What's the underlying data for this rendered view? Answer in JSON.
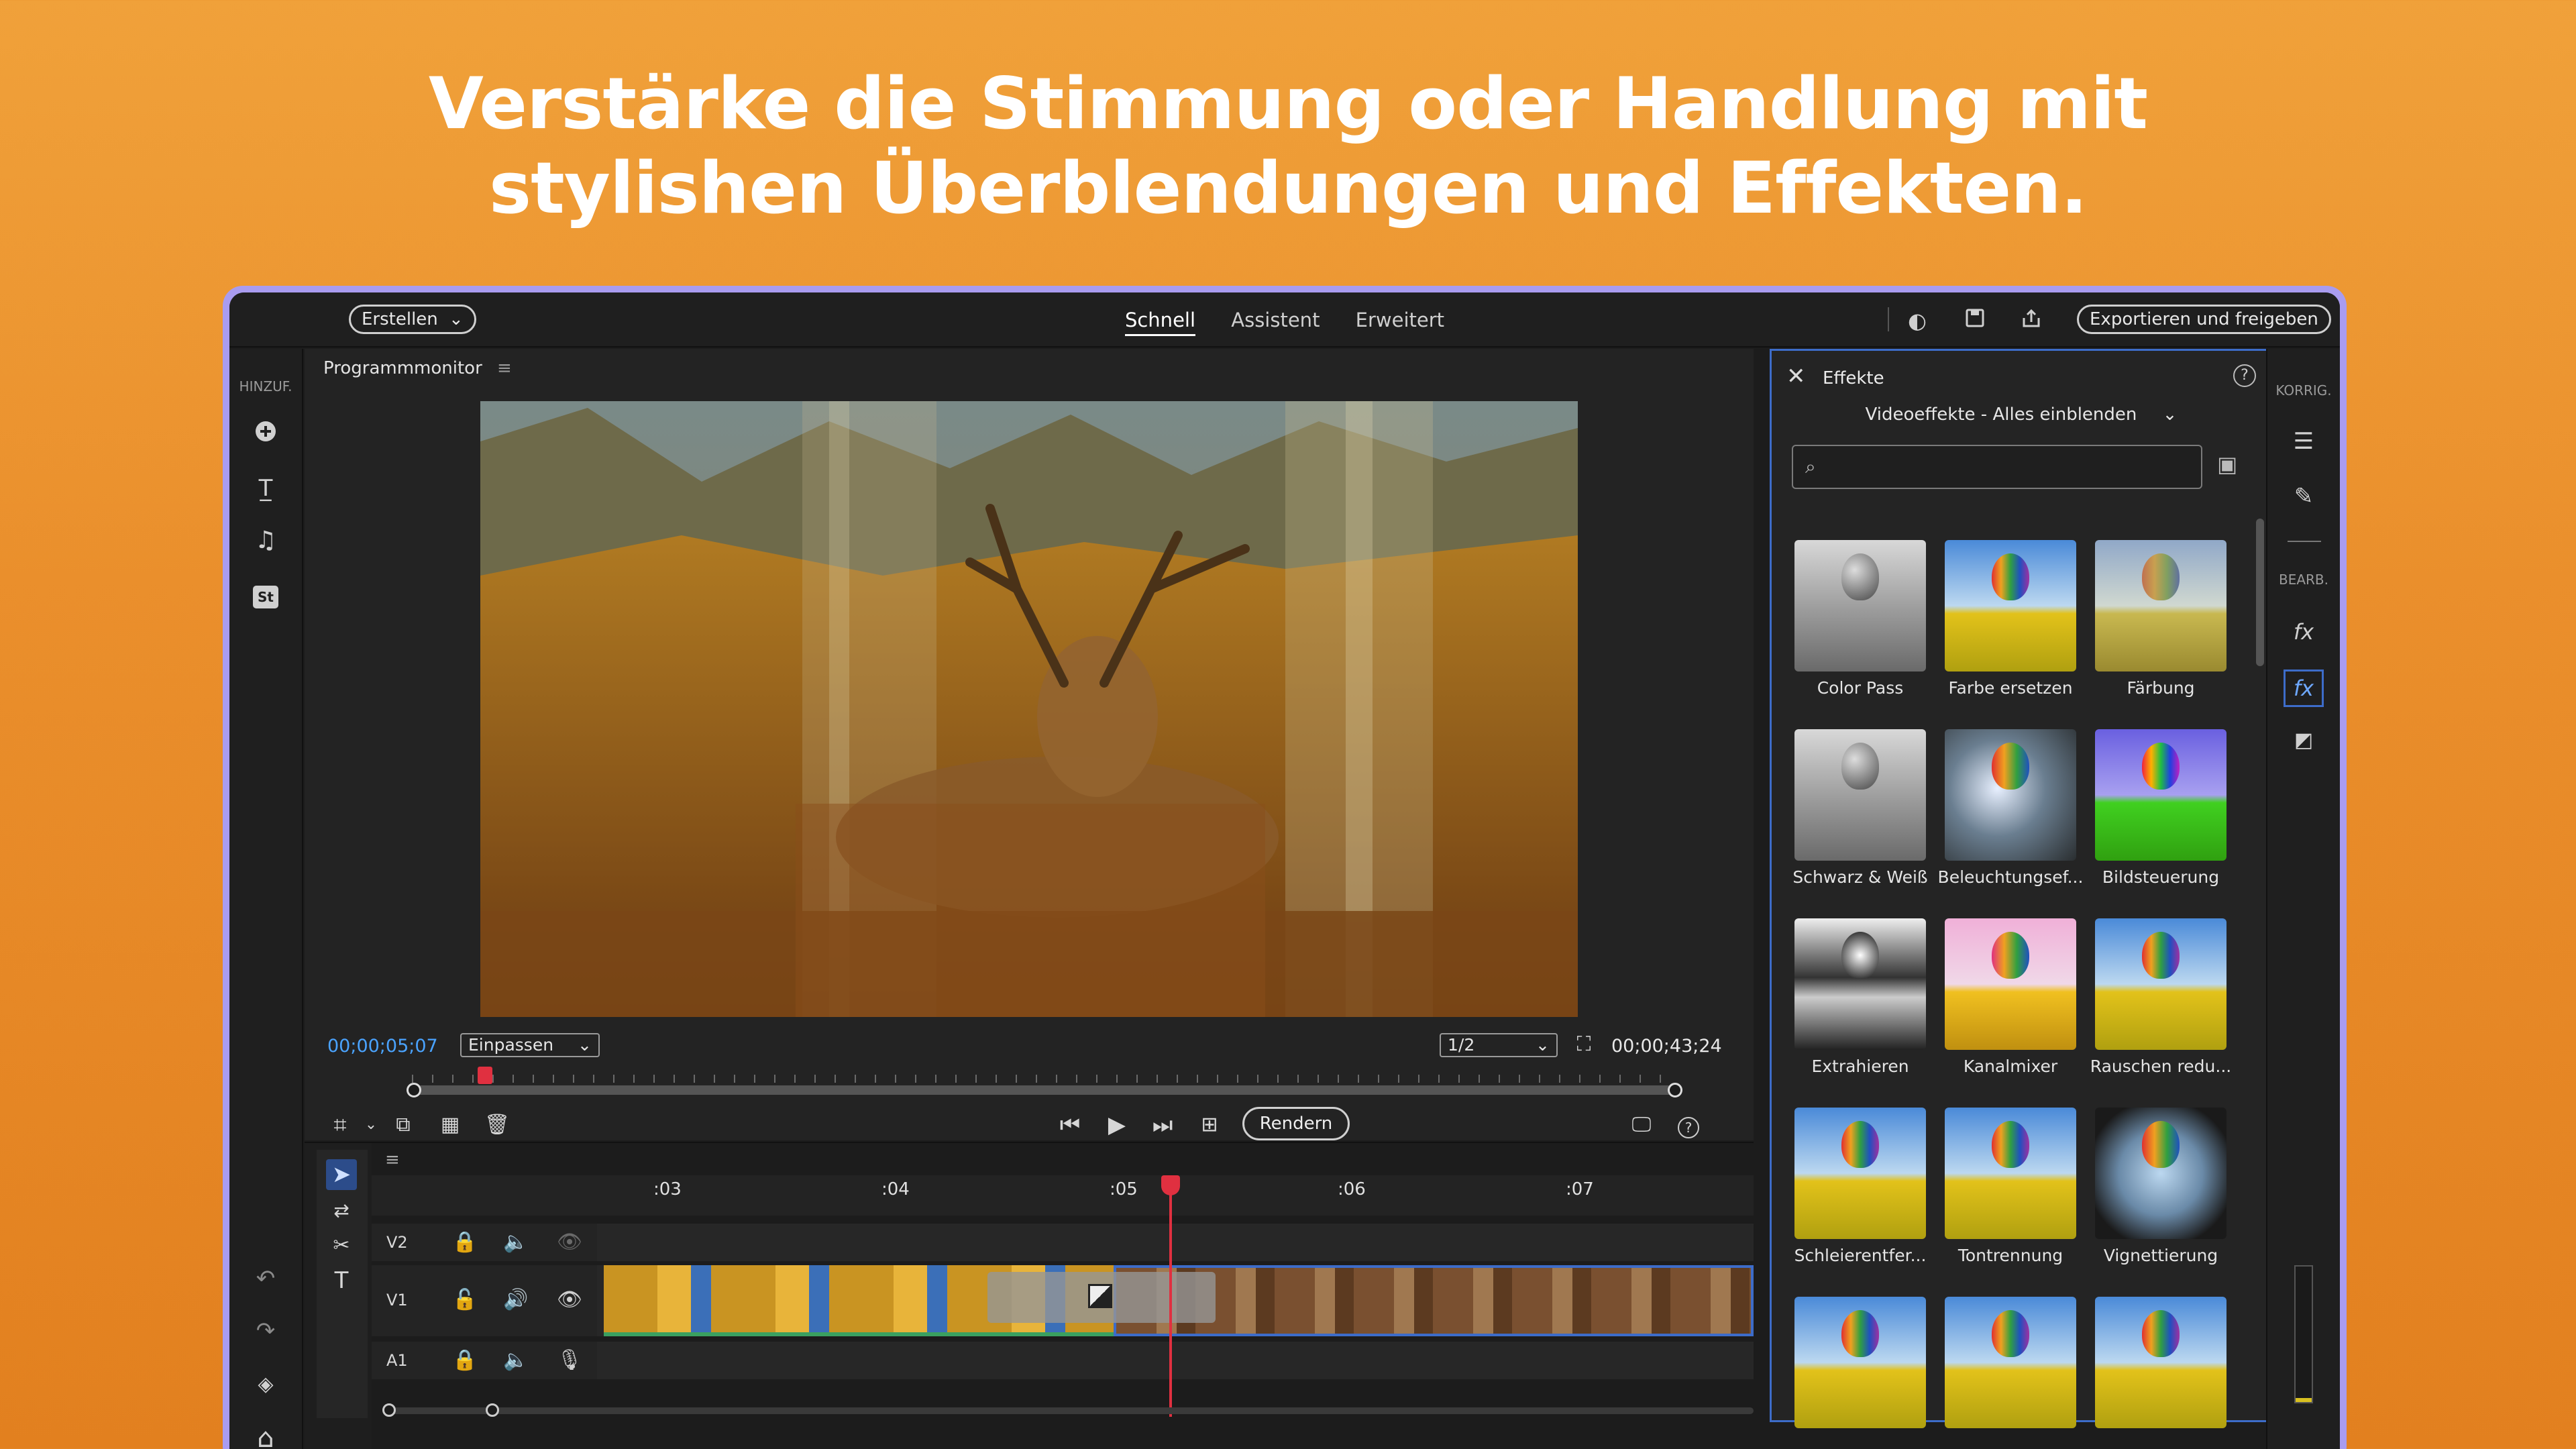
{
  "headline": {
    "line1": "Verstärke die Stimmung oder Handlung mit",
    "line2": "stylishen Überblendungen und Effekten."
  },
  "topbar": {
    "create_label": "Erstellen",
    "modes": [
      "Schnell",
      "Assistent",
      "Erweitert"
    ],
    "active_mode": "Schnell",
    "export_label": "Exportieren und freigeben",
    "icons": [
      "contrast-icon",
      "save-icon",
      "share-icon"
    ]
  },
  "left_rail": {
    "label": "HINZUF.",
    "icons": [
      "add-icon",
      "title-icon",
      "music-icon",
      "stock-icon"
    ],
    "bottom_icons": [
      "undo-icon",
      "redo-icon",
      "organizer-icon",
      "home-icon"
    ]
  },
  "right_rail": {
    "label_top": "KORRIG.",
    "label_bottom": "BEARB.",
    "icons": [
      "adjust-icon",
      "tools-icon",
      "fx-applied-icon",
      "fx-icon",
      "color-icon"
    ]
  },
  "monitor": {
    "title": "Programmmonitor",
    "current_time": "00;00;05;07",
    "fit_option": "Einpassen",
    "resolution_option": "1/2",
    "duration": "00;00;43;24",
    "render_label": "Rendern",
    "playhead_fraction": 0.052
  },
  "timeline": {
    "ticks": [
      ":03",
      ":04",
      ":05",
      ":06",
      ":07"
    ],
    "tracks": [
      "V2",
      "V1",
      "A1"
    ]
  },
  "effects": {
    "title": "Effekte",
    "filter": "Videoeffekte - Alles einblenden",
    "search_placeholder": "",
    "items": [
      {
        "label": "Color Pass",
        "style": "gray"
      },
      {
        "label": "Farbe ersetzen",
        "style": "color"
      },
      {
        "label": "Färbung",
        "style": "tint"
      },
      {
        "label": "Schwarz & Weiß",
        "style": "gray"
      },
      {
        "label": "Beleuchtungsef...",
        "style": "light"
      },
      {
        "label": "Bildsteuerung",
        "style": "vivid"
      },
      {
        "label": "Extrahieren",
        "style": "bw"
      },
      {
        "label": "Kanalmixer",
        "style": "pink"
      },
      {
        "label": "Rauschen redu...",
        "style": "color"
      },
      {
        "label": "Schleierentfer...",
        "style": "color"
      },
      {
        "label": "Tontrennung",
        "style": "color"
      },
      {
        "label": "Vignettierung",
        "style": "vignette"
      },
      {
        "label": "",
        "style": "color"
      },
      {
        "label": "",
        "style": "color"
      },
      {
        "label": "",
        "style": "color"
      }
    ]
  },
  "colors": {
    "accent_blue": "#3d6cc9",
    "timecode_blue": "#4aa3ff",
    "playhead_red": "#e03040",
    "frame_purple": "#a99cf0"
  }
}
